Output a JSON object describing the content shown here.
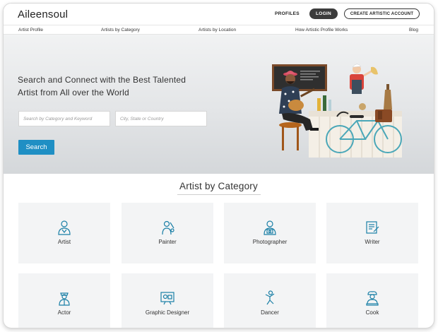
{
  "header": {
    "logo": "Aileensoul",
    "profiles": "PROFILES",
    "login": "LOGIN",
    "create_account": "CREATE ARTISTIC ACCOUNT"
  },
  "subnav": {
    "items": [
      "Artist Profile",
      "Artists by Category",
      "Artists by Location",
      "How Artistic Profile Works",
      "Blog"
    ]
  },
  "hero": {
    "title_line1": "Search and Connect with the Best Talented",
    "title_line2": "Artist from All over the World",
    "category_placeholder": "Search by Category and Keyword",
    "location_placeholder": "City, State or Country",
    "search_label": "Search"
  },
  "categories": {
    "heading": "Artist by Category",
    "items": [
      {
        "label": "Artist",
        "icon": "artist-icon"
      },
      {
        "label": "Painter",
        "icon": "painter-icon"
      },
      {
        "label": "Photographer",
        "icon": "photographer-icon"
      },
      {
        "label": "Writer",
        "icon": "writer-icon"
      },
      {
        "label": "Actor",
        "icon": "actor-icon"
      },
      {
        "label": "Graphic Designer",
        "icon": "graphic-designer-icon"
      },
      {
        "label": "Dancer",
        "icon": "dancer-icon"
      },
      {
        "label": "Cook",
        "icon": "cook-icon"
      }
    ]
  },
  "colors": {
    "accent": "#1f8fc4",
    "icon_stroke": "#1a7fa6",
    "login_bg": "#3c3c3c"
  }
}
